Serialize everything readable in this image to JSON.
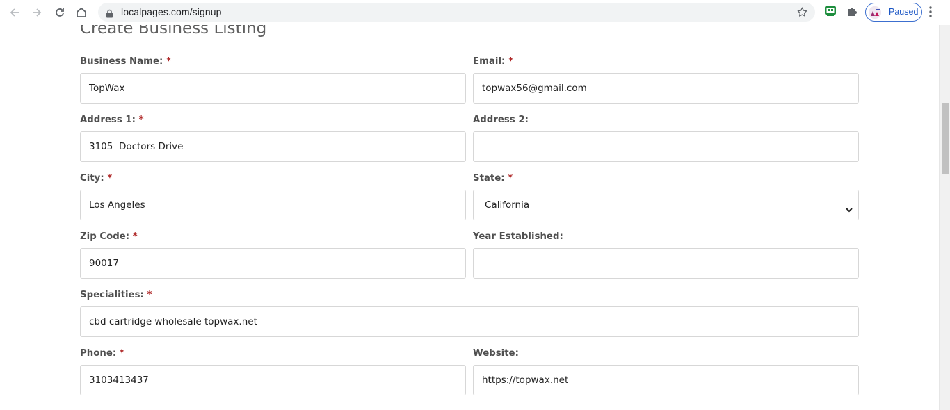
{
  "browser": {
    "url": "localpages.com/signup",
    "profile_status": "Paused",
    "icons": [
      "back-icon",
      "forward-icon",
      "reload-icon",
      "home-icon",
      "lock-icon",
      "bookmark-star-icon",
      "extension-icon",
      "puzzle-icon",
      "more-icon"
    ]
  },
  "page": {
    "title": "Create Business Listing",
    "required_mark": "*",
    "fields": {
      "business_name": {
        "label": "Business Name:",
        "value": "TopWax"
      },
      "email": {
        "label": "Email:",
        "value": "topwax56@gmail.com"
      },
      "address1": {
        "label": "Address 1:",
        "value": "3105  Doctors Drive"
      },
      "address2": {
        "label": "Address 2:",
        "value": ""
      },
      "city": {
        "label": "City:",
        "value": "Los Angeles"
      },
      "state": {
        "label": "State:",
        "value": "California"
      },
      "zip": {
        "label": "Zip Code:",
        "value": "90017"
      },
      "year": {
        "label": "Year Established:",
        "value": ""
      },
      "specialities": {
        "label": "Specialities:",
        "value": "cbd cartridge wholesale topwax.net"
      },
      "phone": {
        "label": "Phone:",
        "value": "3103413437"
      },
      "website": {
        "label": "Website:",
        "value": "https://topwax.net"
      }
    }
  },
  "colors": {
    "required": "#b02a2a",
    "label": "#4f4f4f",
    "accent_profile": "#1a55c4",
    "input_border": "#d7d7d7"
  }
}
